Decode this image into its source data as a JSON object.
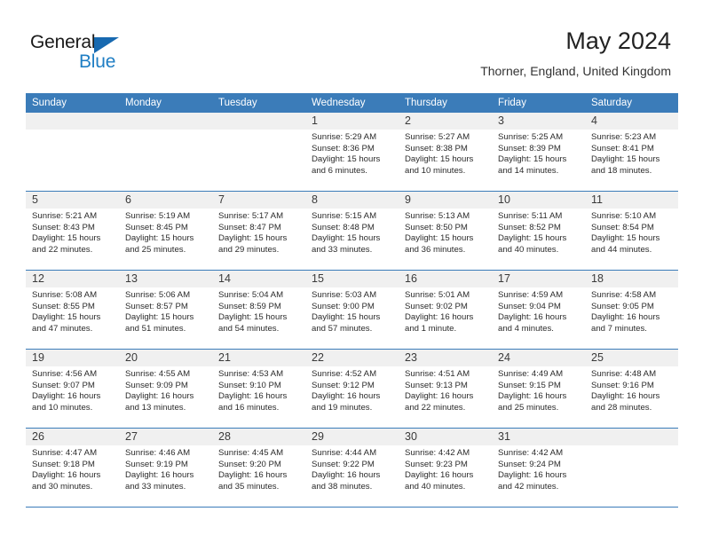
{
  "brand": {
    "name_part1": "General",
    "name_part2": "Blue",
    "triangle_color": "#1769b0",
    "blue_color": "#1f7ec4"
  },
  "header": {
    "title": "May 2024",
    "subtitle": "Thorner, England, United Kingdom"
  },
  "colors": {
    "header_blue": "#3b7cb9",
    "daynum_band": "#f0f0f0",
    "cell_background": "#ffffff",
    "text": "#222222"
  },
  "weekdays": [
    "Sunday",
    "Monday",
    "Tuesday",
    "Wednesday",
    "Thursday",
    "Friday",
    "Saturday"
  ],
  "labels": {
    "sunrise_prefix": "Sunrise:",
    "sunset_prefix": "Sunset:",
    "daylight_prefix": "Daylight:"
  },
  "weeks": [
    [
      {
        "day": "",
        "sunrise": "",
        "sunset": "",
        "daylight": "",
        "empty": true
      },
      {
        "day": "",
        "sunrise": "",
        "sunset": "",
        "daylight": "",
        "empty": true
      },
      {
        "day": "",
        "sunrise": "",
        "sunset": "",
        "daylight": "",
        "empty": true
      },
      {
        "day": "1",
        "sunrise": "Sunrise: 5:29 AM",
        "sunset": "Sunset: 8:36 PM",
        "daylight": "Daylight: 15 hours and 6 minutes."
      },
      {
        "day": "2",
        "sunrise": "Sunrise: 5:27 AM",
        "sunset": "Sunset: 8:38 PM",
        "daylight": "Daylight: 15 hours and 10 minutes."
      },
      {
        "day": "3",
        "sunrise": "Sunrise: 5:25 AM",
        "sunset": "Sunset: 8:39 PM",
        "daylight": "Daylight: 15 hours and 14 minutes."
      },
      {
        "day": "4",
        "sunrise": "Sunrise: 5:23 AM",
        "sunset": "Sunset: 8:41 PM",
        "daylight": "Daylight: 15 hours and 18 minutes."
      }
    ],
    [
      {
        "day": "5",
        "sunrise": "Sunrise: 5:21 AM",
        "sunset": "Sunset: 8:43 PM",
        "daylight": "Daylight: 15 hours and 22 minutes."
      },
      {
        "day": "6",
        "sunrise": "Sunrise: 5:19 AM",
        "sunset": "Sunset: 8:45 PM",
        "daylight": "Daylight: 15 hours and 25 minutes."
      },
      {
        "day": "7",
        "sunrise": "Sunrise: 5:17 AM",
        "sunset": "Sunset: 8:47 PM",
        "daylight": "Daylight: 15 hours and 29 minutes."
      },
      {
        "day": "8",
        "sunrise": "Sunrise: 5:15 AM",
        "sunset": "Sunset: 8:48 PM",
        "daylight": "Daylight: 15 hours and 33 minutes."
      },
      {
        "day": "9",
        "sunrise": "Sunrise: 5:13 AM",
        "sunset": "Sunset: 8:50 PM",
        "daylight": "Daylight: 15 hours and 36 minutes."
      },
      {
        "day": "10",
        "sunrise": "Sunrise: 5:11 AM",
        "sunset": "Sunset: 8:52 PM",
        "daylight": "Daylight: 15 hours and 40 minutes."
      },
      {
        "day": "11",
        "sunrise": "Sunrise: 5:10 AM",
        "sunset": "Sunset: 8:54 PM",
        "daylight": "Daylight: 15 hours and 44 minutes."
      }
    ],
    [
      {
        "day": "12",
        "sunrise": "Sunrise: 5:08 AM",
        "sunset": "Sunset: 8:55 PM",
        "daylight": "Daylight: 15 hours and 47 minutes."
      },
      {
        "day": "13",
        "sunrise": "Sunrise: 5:06 AM",
        "sunset": "Sunset: 8:57 PM",
        "daylight": "Daylight: 15 hours and 51 minutes."
      },
      {
        "day": "14",
        "sunrise": "Sunrise: 5:04 AM",
        "sunset": "Sunset: 8:59 PM",
        "daylight": "Daylight: 15 hours and 54 minutes."
      },
      {
        "day": "15",
        "sunrise": "Sunrise: 5:03 AM",
        "sunset": "Sunset: 9:00 PM",
        "daylight": "Daylight: 15 hours and 57 minutes."
      },
      {
        "day": "16",
        "sunrise": "Sunrise: 5:01 AM",
        "sunset": "Sunset: 9:02 PM",
        "daylight": "Daylight: 16 hours and 1 minute."
      },
      {
        "day": "17",
        "sunrise": "Sunrise: 4:59 AM",
        "sunset": "Sunset: 9:04 PM",
        "daylight": "Daylight: 16 hours and 4 minutes."
      },
      {
        "day": "18",
        "sunrise": "Sunrise: 4:58 AM",
        "sunset": "Sunset: 9:05 PM",
        "daylight": "Daylight: 16 hours and 7 minutes."
      }
    ],
    [
      {
        "day": "19",
        "sunrise": "Sunrise: 4:56 AM",
        "sunset": "Sunset: 9:07 PM",
        "daylight": "Daylight: 16 hours and 10 minutes."
      },
      {
        "day": "20",
        "sunrise": "Sunrise: 4:55 AM",
        "sunset": "Sunset: 9:09 PM",
        "daylight": "Daylight: 16 hours and 13 minutes."
      },
      {
        "day": "21",
        "sunrise": "Sunrise: 4:53 AM",
        "sunset": "Sunset: 9:10 PM",
        "daylight": "Daylight: 16 hours and 16 minutes."
      },
      {
        "day": "22",
        "sunrise": "Sunrise: 4:52 AM",
        "sunset": "Sunset: 9:12 PM",
        "daylight": "Daylight: 16 hours and 19 minutes."
      },
      {
        "day": "23",
        "sunrise": "Sunrise: 4:51 AM",
        "sunset": "Sunset: 9:13 PM",
        "daylight": "Daylight: 16 hours and 22 minutes."
      },
      {
        "day": "24",
        "sunrise": "Sunrise: 4:49 AM",
        "sunset": "Sunset: 9:15 PM",
        "daylight": "Daylight: 16 hours and 25 minutes."
      },
      {
        "day": "25",
        "sunrise": "Sunrise: 4:48 AM",
        "sunset": "Sunset: 9:16 PM",
        "daylight": "Daylight: 16 hours and 28 minutes."
      }
    ],
    [
      {
        "day": "26",
        "sunrise": "Sunrise: 4:47 AM",
        "sunset": "Sunset: 9:18 PM",
        "daylight": "Daylight: 16 hours and 30 minutes."
      },
      {
        "day": "27",
        "sunrise": "Sunrise: 4:46 AM",
        "sunset": "Sunset: 9:19 PM",
        "daylight": "Daylight: 16 hours and 33 minutes."
      },
      {
        "day": "28",
        "sunrise": "Sunrise: 4:45 AM",
        "sunset": "Sunset: 9:20 PM",
        "daylight": "Daylight: 16 hours and 35 minutes."
      },
      {
        "day": "29",
        "sunrise": "Sunrise: 4:44 AM",
        "sunset": "Sunset: 9:22 PM",
        "daylight": "Daylight: 16 hours and 38 minutes."
      },
      {
        "day": "30",
        "sunrise": "Sunrise: 4:42 AM",
        "sunset": "Sunset: 9:23 PM",
        "daylight": "Daylight: 16 hours and 40 minutes."
      },
      {
        "day": "31",
        "sunrise": "Sunrise: 4:42 AM",
        "sunset": "Sunset: 9:24 PM",
        "daylight": "Daylight: 16 hours and 42 minutes."
      },
      {
        "day": "",
        "sunrise": "",
        "sunset": "",
        "daylight": "",
        "empty": true
      }
    ]
  ]
}
